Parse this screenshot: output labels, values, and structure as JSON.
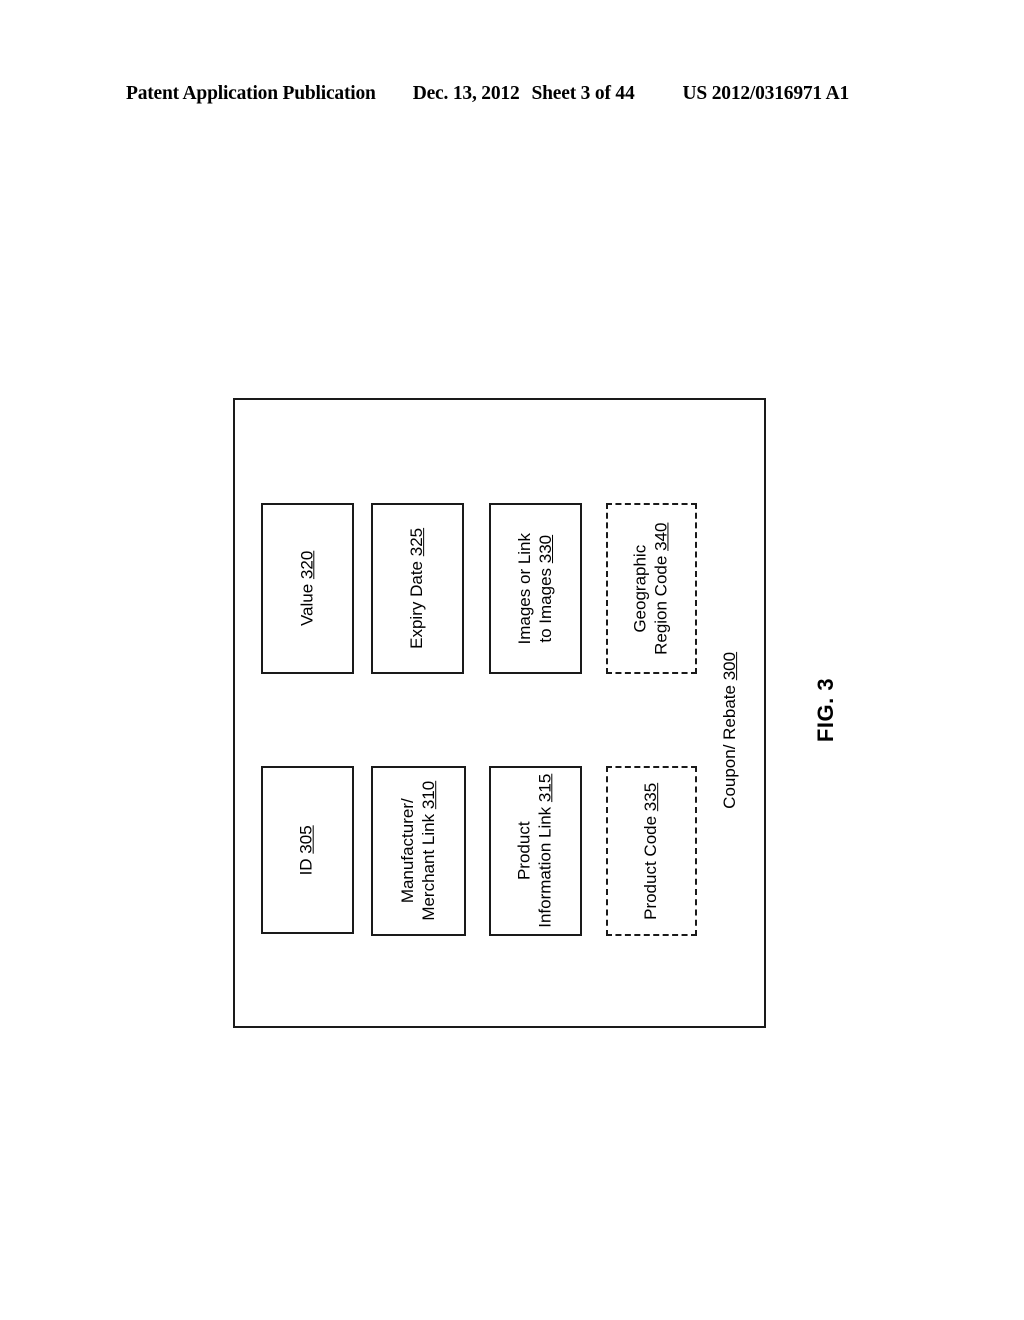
{
  "header": {
    "publication": "Patent Application Publication",
    "date": "Dec. 13, 2012",
    "sheet": "Sheet 3 of 44",
    "number": "US 2012/0316971 A1"
  },
  "figure": {
    "caption": "FIG. 3",
    "container": {
      "label_text": "Coupon/ Rebate",
      "label_ref": "300"
    },
    "blocks": [
      {
        "id": "value",
        "lines": [
          "Value"
        ],
        "ref": "320",
        "style": "solid"
      },
      {
        "id": "expiry_date",
        "lines": [
          "Expiry Date"
        ],
        "ref": "325",
        "style": "solid"
      },
      {
        "id": "images_or_link",
        "lines": [
          "Images or Link",
          "to Images"
        ],
        "ref": "330",
        "style": "solid"
      },
      {
        "id": "geographic_region_code",
        "lines": [
          "Geographic",
          "Region Code"
        ],
        "ref": "340",
        "style": "dashed"
      },
      {
        "id": "identifier",
        "lines": [
          "ID"
        ],
        "ref": "305",
        "style": "solid"
      },
      {
        "id": "manufacturer_merchant_link",
        "lines": [
          "Manufacturer/",
          "Merchant Link"
        ],
        "ref": "310",
        "style": "solid"
      },
      {
        "id": "product_information_link",
        "lines": [
          "Product",
          "Information Link"
        ],
        "ref": "315",
        "style": "solid"
      },
      {
        "id": "product_code",
        "lines": [
          "Product Code"
        ],
        "ref": "335",
        "style": "dashed"
      }
    ]
  }
}
